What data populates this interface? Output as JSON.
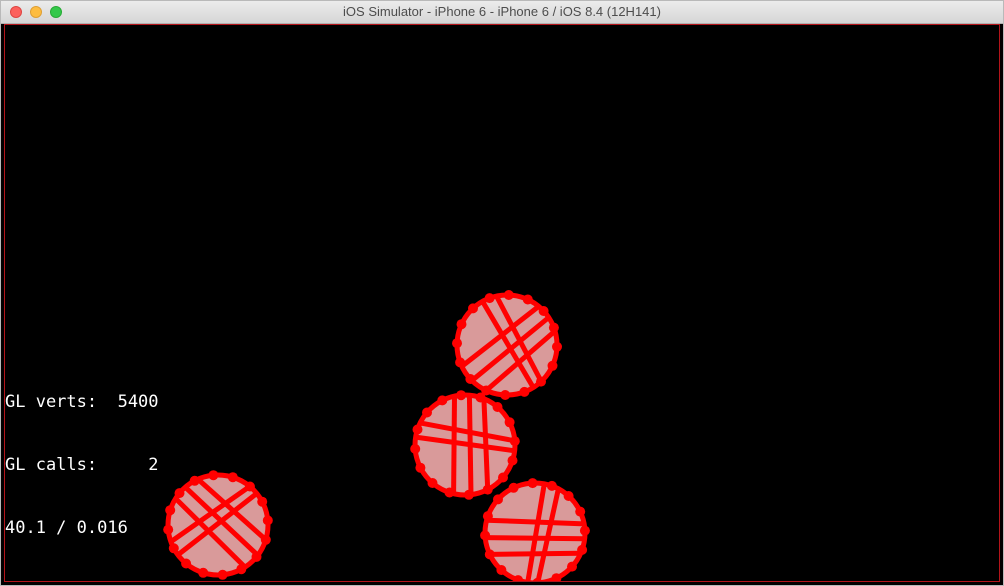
{
  "window": {
    "title": "iOS Simulator - iPhone 6 - iPhone 6 / iOS 8.4 (12H141)",
    "buttons": [
      "close",
      "minimize",
      "zoom"
    ]
  },
  "scene": {
    "background": "#000000",
    "outline_color": "#ff0000",
    "fill_color": "#d99a9a",
    "objects": [
      {
        "name": "gear-1",
        "icon": "red-gear-circle"
      },
      {
        "name": "gear-2",
        "icon": "red-gear-circle"
      },
      {
        "name": "gear-3",
        "icon": "red-gear-circle"
      },
      {
        "name": "gear-4",
        "icon": "red-gear-circle"
      }
    ]
  },
  "stats": {
    "verts_line": "GL verts:  5400",
    "calls_line": "GL calls:     2",
    "fps_line": "40.1 / 0.016"
  }
}
